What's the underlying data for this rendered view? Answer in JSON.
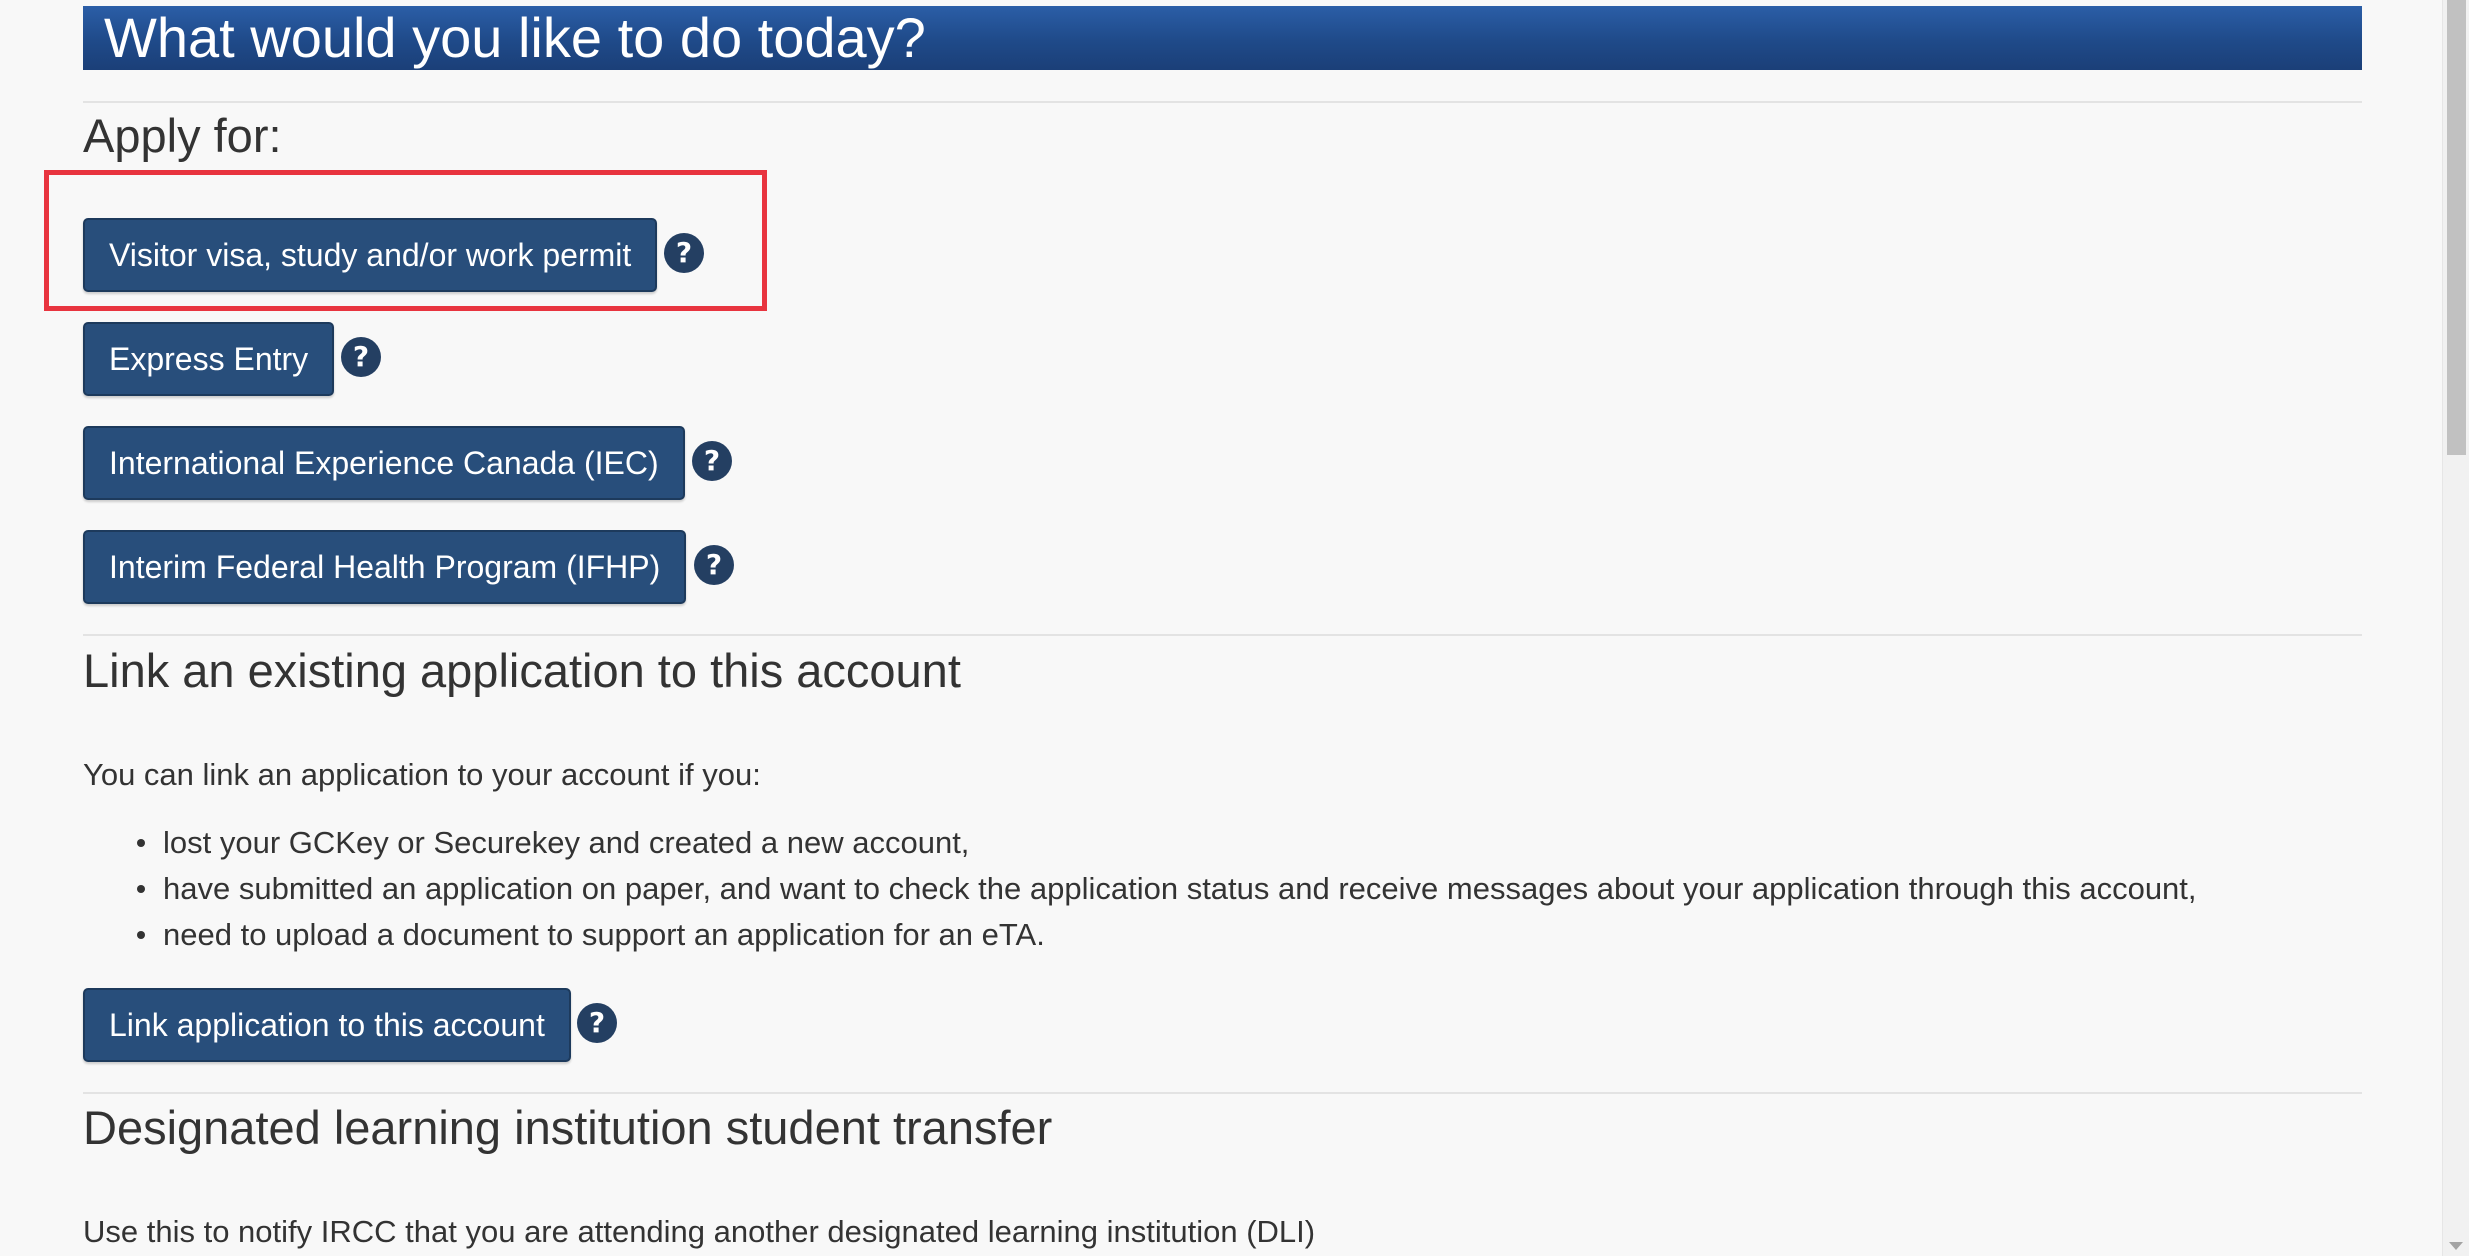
{
  "banner": {
    "title": "What would you like to do today?"
  },
  "apply_section": {
    "heading": "Apply for:",
    "buttons": [
      {
        "label": "Visitor visa, study and/or work permit",
        "help_glyph": "?"
      },
      {
        "label": "Express Entry",
        "help_glyph": "?"
      },
      {
        "label": "International Experience Canada (IEC)",
        "help_glyph": "?"
      },
      {
        "label": "Interim Federal Health Program (IFHP)",
        "help_glyph": "?"
      }
    ]
  },
  "link_section": {
    "heading": "Link an existing application to this account",
    "intro": "You can link an application to your account if you:",
    "bullets": [
      "lost your GCKey or Securekey and created a new account,",
      "have submitted an application on paper, and want to check the application status and receive messages about your application through this account,",
      "need to upload a document to support an application for an eTA."
    ],
    "button_label": "Link application to this account",
    "help_glyph": "?"
  },
  "dli_section": {
    "heading": "Designated learning institution student transfer",
    "intro": "Use this to notify IRCC that you are attending another designated learning institution (DLI)"
  },
  "icons": {
    "help": "question-circle-icon",
    "scroll_down": "scroll-down-arrow-icon"
  },
  "colors": {
    "banner_top": "#2b5ea7",
    "banner_bottom": "#1b3f78",
    "button_bg": "#284e7b",
    "help_icon_bg": "#243f62",
    "highlight_border": "#e8343f",
    "page_bg": "#f8f8f8"
  }
}
